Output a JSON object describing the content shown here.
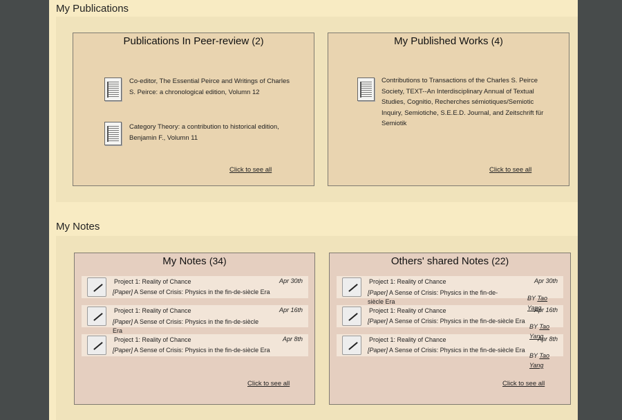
{
  "publications": {
    "section_title": "My Publications",
    "peer_review": {
      "title": "Publications In Peer-review",
      "count": "(2)",
      "items": [
        {
          "text": "Co-editor, The Essential Peirce and Writings of Charles S. Peirce: a chronological edition, Volumn 12"
        },
        {
          "text": "Category Theory: a contribution to historical edition, Benjamin F., Volumn 11"
        }
      ],
      "see_all": "Click to see all"
    },
    "published": {
      "title": "My Published Works",
      "count": "(4)",
      "items": [
        {
          "text": "Contributions to Transactions of the Charles S. Peirce Society, TEXT--An Interdisciplinary Annual of Textual Studies, Cognitio, Recherches sémiotiques/Semiotic Inquiry, Semiotiche, S.E.E.D. Journal, and Zeitschrift für Semiotik"
        }
      ],
      "see_all": "Click to see all"
    }
  },
  "notes": {
    "section_title": "My Notes",
    "my_notes": {
      "title": "My Notes",
      "count": "(34)",
      "items": [
        {
          "project": "Project 1: Reality of Chance",
          "date": "Apr 30th",
          "tag": "[Paper]",
          "paper": " A Sense of Crisis: Physics in the fin-de-siècle Era"
        },
        {
          "project": "Project 1: Reality of Chance",
          "date": "Apr 16th",
          "tag": "[Paper]",
          "paper": " A Sense of Crisis: Physics in the fin-de-siècle Era"
        },
        {
          "project": "Project 1: Reality of Chance",
          "date": "Apr 8th",
          "tag": "[Paper]",
          "paper": " A Sense of Crisis: Physics in the fin-de-siècle Era"
        }
      ],
      "see_all": "Click to see all"
    },
    "shared_notes": {
      "title": "Others' shared Notes",
      "count": "(22)",
      "items": [
        {
          "project": "Project 1: Reality of Chance",
          "date": "Apr 30th",
          "tag": "[Paper]",
          "paper": " A Sense of Crisis: Physics in the fin-de-siècle Era",
          "by_label": "BY",
          "by_name": "Tao Yang"
        },
        {
          "project": "Project 1: Reality of Chance",
          "date": "Apr 16th",
          "tag": "[Paper]",
          "paper": " A Sense of Crisis: Physics in the fin-de-siècle Era",
          "by_label": "BY",
          "by_name": "Tao Yang"
        },
        {
          "project": "Project 1: Reality of Chance",
          "date": "Apr 8th",
          "tag": "[Paper]",
          "paper": " A Sense of Crisis: Physics in the fin-de-siècle Era",
          "by_label": "BY",
          "by_name": "Tao Yang"
        }
      ],
      "see_all": "Click to see all"
    }
  }
}
